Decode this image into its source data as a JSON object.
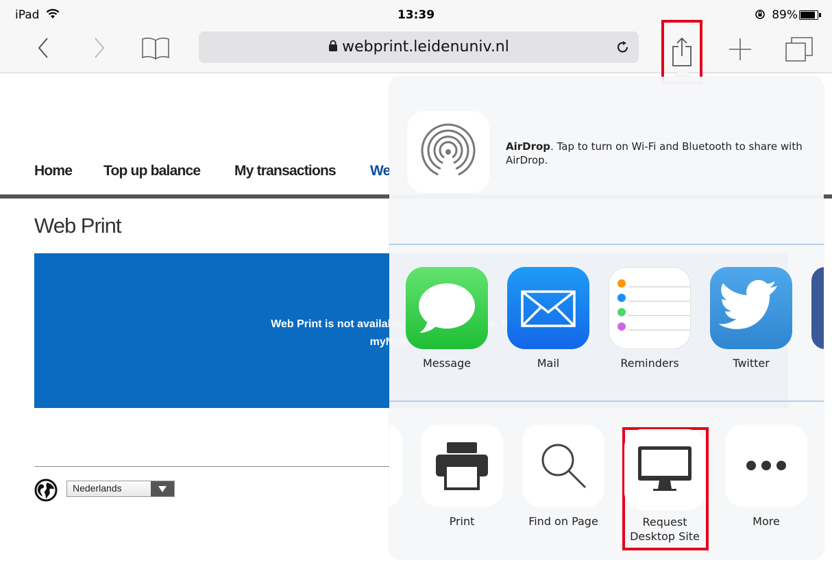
{
  "status": {
    "device": "iPad",
    "time": "13:39",
    "battery": "89%"
  },
  "browser": {
    "url": "webprint.leidenuniv.nl"
  },
  "page": {
    "nav": [
      "Home",
      "Top up balance",
      "My transactions",
      "We"
    ],
    "title": "Web Print",
    "message_line1": "Web Print is not available on mobile device. Plea",
    "message_line2": "myNetPay.",
    "language": "Nederlands"
  },
  "share": {
    "airdrop_title": "AirDrop",
    "airdrop_text": ". Tap to turn on Wi-Fi and Bluetooth to share with AirDrop.",
    "apps": [
      {
        "label": "Message",
        "icon": "messages-icon"
      },
      {
        "label": "Mail",
        "icon": "mail-icon"
      },
      {
        "label": "Reminders",
        "icon": "reminders-icon"
      },
      {
        "label": "Twitter",
        "icon": "twitter-icon"
      }
    ],
    "actions": [
      {
        "label": "Print",
        "icon": "printer-icon"
      },
      {
        "label": "Find on Page",
        "icon": "magnifier-icon"
      },
      {
        "label": "Request\nDesktop Site",
        "icon": "desktop-icon"
      },
      {
        "label": "More",
        "icon": "more-icon"
      }
    ]
  },
  "colors": {
    "highlight": "#e3001b",
    "page_blue": "#0b6bc0",
    "ios_blue": "#1a7cf5"
  }
}
